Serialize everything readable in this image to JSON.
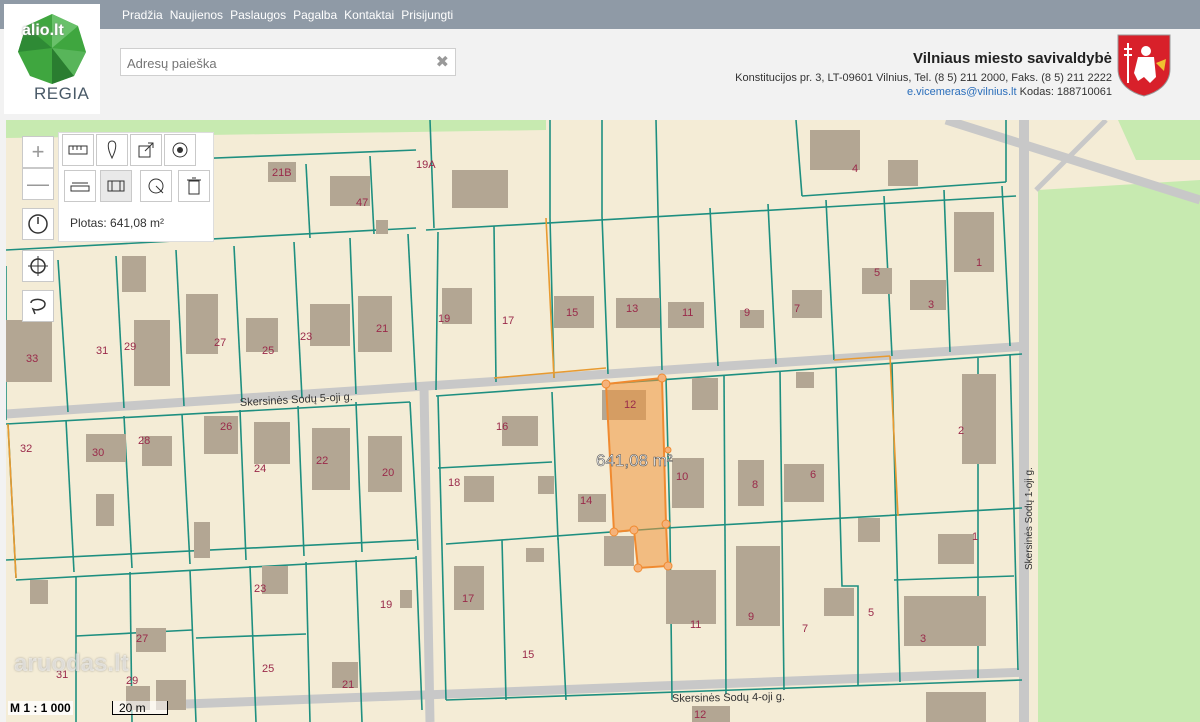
{
  "nav": [
    "Pradžia",
    "Naujienos",
    "Paslaugos",
    "Pagalba",
    "Kontaktai",
    "Prisijungti"
  ],
  "logo": {
    "url_text": "alio.lt",
    "name": "REGIA"
  },
  "search": {
    "placeholder": "Adresų paieška"
  },
  "municipality": {
    "name": "Vilniaus miesto savivaldybė",
    "address": "Konstitucijos pr. 3, LT-09601 Vilnius, Tel. (8 5) 211 2000, Faks. (8 5) 211 2222",
    "email": "e.vicemeras@vilnius.lt",
    "code": "Kodas: 188710061"
  },
  "tools": {
    "area_readout": "Plotas: 641,08 m²",
    "icons": [
      "ruler-icon",
      "marker-icon",
      "export-icon",
      "target-icon",
      "measure-distance-icon",
      "measure-area-icon",
      "style-icon",
      "trash-icon"
    ]
  },
  "map": {
    "selected_area_label": "641,08 m²",
    "streets": [
      "Skersinės Sodų 5-oji g.",
      "Skersinės Sodų 4-oji g.",
      "Skersinės Sodų 1-oji g."
    ],
    "parcel_labels": [
      "21B",
      "19A",
      "47",
      "4",
      "33",
      "31",
      "29",
      "27",
      "25",
      "23",
      "21",
      "19",
      "17",
      "15",
      "13",
      "11",
      "9",
      "7",
      "5",
      "3",
      "1",
      "32",
      "30",
      "28",
      "26",
      "24",
      "22",
      "20",
      "16",
      "18",
      "14",
      "12",
      "10",
      "8",
      "6",
      "2",
      "1",
      "23",
      "19",
      "17",
      "15",
      "11",
      "9",
      "7",
      "5",
      "3",
      "27",
      "25",
      "21",
      "29",
      "31",
      "12"
    ],
    "scale_text": "M 1 : 1 000",
    "scale_bar": "20 m",
    "watermark": "aruodas.lt",
    "colors": {
      "land": "#f4ecd6",
      "parcel_line": "#1e8f80",
      "road": "#c9c9c9",
      "building": "#b3a693",
      "green": "#c7eab0",
      "selection": "#f0a050"
    }
  }
}
